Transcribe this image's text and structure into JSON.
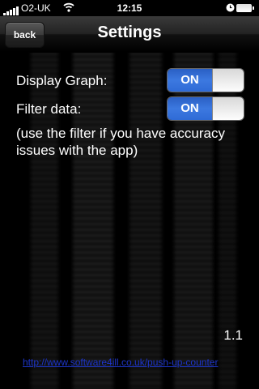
{
  "status_bar": {
    "carrier": "O2-UK",
    "time": "12:15",
    "icons": [
      "signal-icon",
      "wifi-icon",
      "clock-icon",
      "battery-icon"
    ]
  },
  "navbar": {
    "back_label": "back",
    "title": "Settings"
  },
  "settings": [
    {
      "label": "Display Graph:",
      "value": "ON"
    },
    {
      "label": "Filter data:",
      "value": "ON"
    }
  ],
  "hint": "(use the filter if you have accuracy issues with the app)",
  "version": "1.1",
  "link": "http://www.software4ill.co.uk/push-up-counter",
  "colors": {
    "toggle_on": "#3c79e0",
    "link": "#1d35c9",
    "background": "#000000"
  }
}
